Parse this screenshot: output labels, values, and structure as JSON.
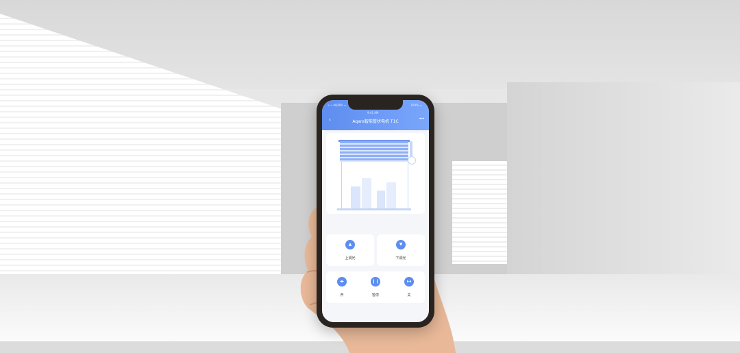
{
  "app": {
    "title": "Aqara智能管状电机 T1C",
    "status_carrier": "••• AQARA ᯤ",
    "status_time": "9:41 AM",
    "status_battery": "100% ▭"
  },
  "controls": {
    "up_label": "上调光",
    "down_label": "下调光",
    "open_label": "开",
    "pause_label": "暂停",
    "close_label": "关"
  },
  "icons": {
    "back": "‹",
    "more": "•••",
    "up": "▲",
    "down": "▼",
    "open": "◂▸",
    "pause": "❙❙",
    "close": "▸◂"
  },
  "colors": {
    "accent": "#5d8df0",
    "header_end": "#7aa6fb",
    "screen_bg": "#f4f6fa"
  }
}
